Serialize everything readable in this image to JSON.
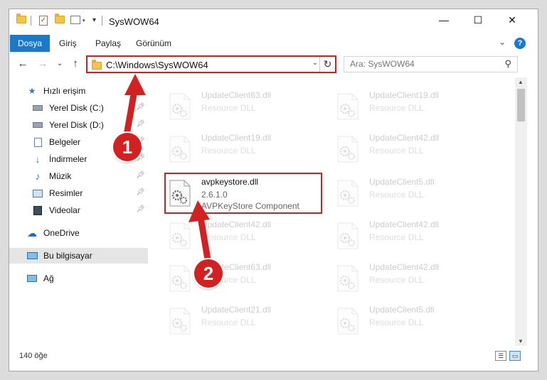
{
  "titlebar": {
    "title": "SysWOW64",
    "minimize": "—",
    "maximize": "☐",
    "close": "✕"
  },
  "ribbon": {
    "tabs": [
      "Dosya",
      "Giriş",
      "Paylaş",
      "Görünüm"
    ],
    "help": "?",
    "expand": "⌄"
  },
  "nav": {
    "back": "←",
    "forward": "→",
    "recent": "⌄",
    "up": "↑",
    "address_path": "C:\\Windows\\SysWOW64",
    "address_dropdown": "⌄",
    "refresh": "↻",
    "search_placeholder": "Ara: SysWOW64",
    "search_icon": "search-icon"
  },
  "sidebar": {
    "items": [
      {
        "label": "Hızlı erişim",
        "icon": "star-icon",
        "pinned": false
      },
      {
        "label": "Yerel Disk (C:)",
        "icon": "drive-icon",
        "pinned": true
      },
      {
        "label": "Yerel Disk (D:)",
        "icon": "drive-icon",
        "pinned": true
      },
      {
        "label": "Belgeler",
        "icon": "documents-icon",
        "pinned": true
      },
      {
        "label": "İndirmeler",
        "icon": "downloads-icon",
        "pinned": true
      },
      {
        "label": "Müzik",
        "icon": "music-icon",
        "pinned": true
      },
      {
        "label": "Resimler",
        "icon": "pictures-icon",
        "pinned": true
      },
      {
        "label": "Videolar",
        "icon": "videos-icon",
        "pinned": true
      },
      {
        "label": "OneDrive",
        "icon": "cloud-icon",
        "pinned": false
      },
      {
        "label": "Bu bilgisayar",
        "icon": "computer-icon",
        "pinned": false,
        "selected": true
      },
      {
        "label": "Ağ",
        "icon": "network-icon",
        "pinned": false
      }
    ]
  },
  "files": [
    {
      "name": "UpdateClient63.dll",
      "line2": "Resource DLL",
      "line3": "",
      "faded": true
    },
    {
      "name": "UpdateClient19.dll",
      "line2": "Resource DLL",
      "line3": "",
      "faded": true
    },
    {
      "name": "UpdateClient19.dll",
      "line2": "Resource DLL",
      "line3": "",
      "faded": true
    },
    {
      "name": "UpdateClient42.dll",
      "line2": "Resource DLL",
      "line3": "",
      "faded": true
    },
    {
      "name": "avpkeystore.dll",
      "line2": "2.6.1.0",
      "line3": "AVPKeyStore Component",
      "faded": false,
      "highlight": true
    },
    {
      "name": "UpdateClient5.dll",
      "line2": "Resource DLL",
      "line3": "",
      "faded": true
    },
    {
      "name": "UpdateClient42.dll",
      "line2": "Resource DLL",
      "line3": "",
      "faded": true
    },
    {
      "name": "UpdateClient42.dll",
      "line2": "Resource DLL",
      "line3": "",
      "faded": true
    },
    {
      "name": "UpdateClient63.dll",
      "line2": "Resource DLL",
      "line3": "",
      "faded": true
    },
    {
      "name": "UpdateClient42.dll",
      "line2": "Resource DLL",
      "line3": "",
      "faded": true
    },
    {
      "name": "UpdateClient21.dll",
      "line2": "Resource DLL",
      "line3": "",
      "faded": true
    },
    {
      "name": "UpdateClient5.dll",
      "line2": "Resource DLL",
      "line3": "",
      "faded": true
    }
  ],
  "status": {
    "item_count": "140 öğe"
  },
  "annotations": {
    "step1": "1",
    "step2": "2",
    "color": "#d32020"
  }
}
